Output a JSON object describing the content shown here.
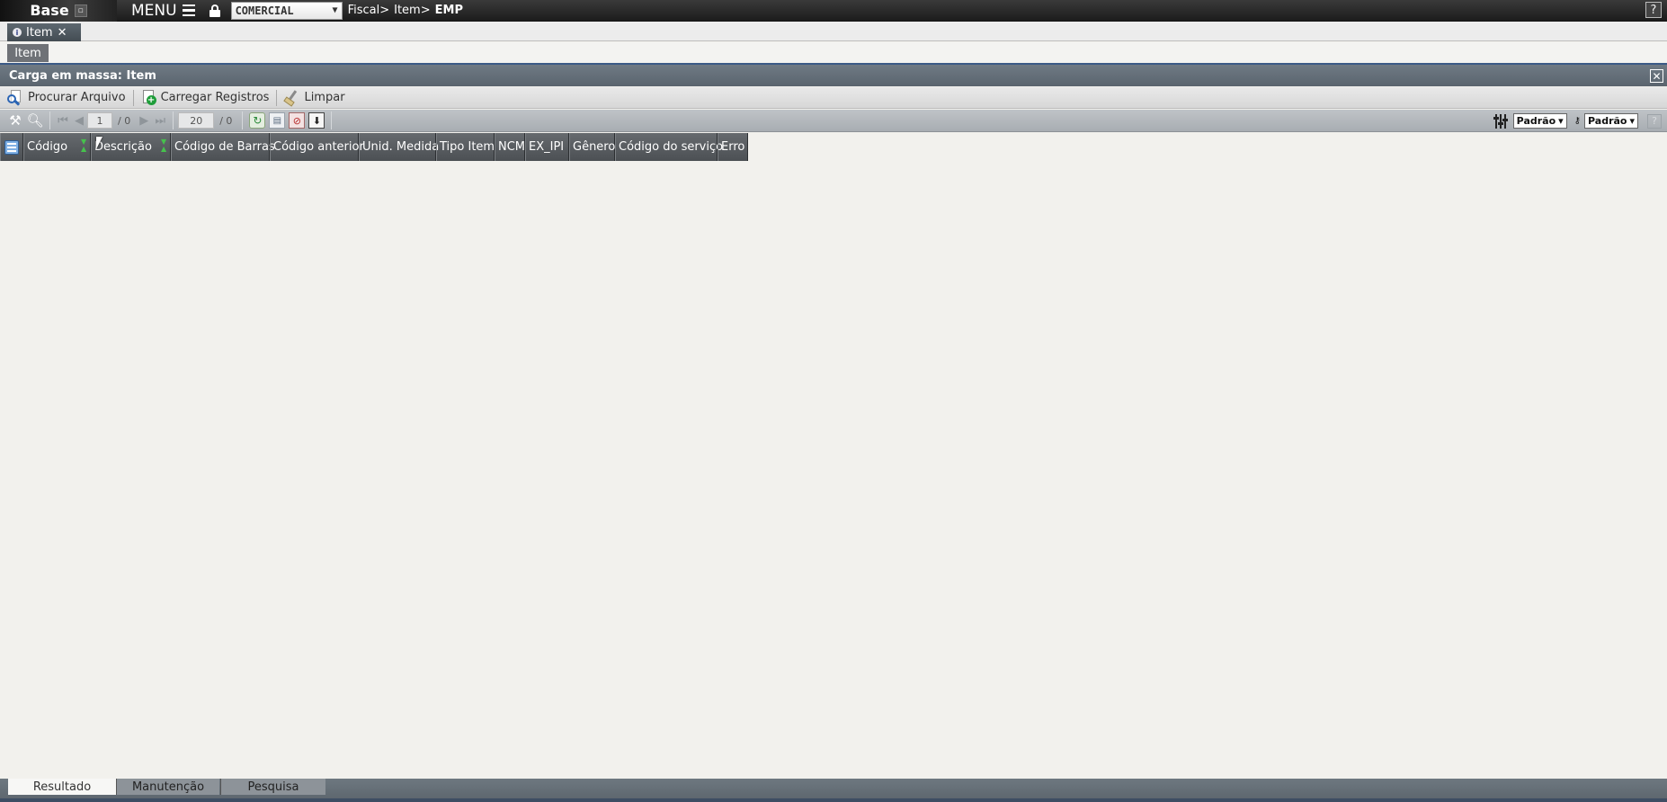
{
  "topbar": {
    "brand": "Base",
    "menu_label": "MENU",
    "company": "COMERCIAL",
    "breadcrumb": [
      "Fiscal>",
      "Item>",
      "EMP"
    ],
    "help": "?"
  },
  "doc_tab": {
    "label": "Item",
    "close": "✕"
  },
  "sub_tab": {
    "label": "Item"
  },
  "panel": {
    "title": "Carga em massa: Item",
    "close": "✕"
  },
  "actions": {
    "browse": "Procurar Arquivo",
    "load": "Carregar Registros",
    "clear": "Limpar"
  },
  "pager": {
    "page": "1",
    "page_total": "/ 0",
    "rows": "20",
    "rows_total": "/ 0"
  },
  "view_select": "Padrão",
  "key_select": "Padrão",
  "columns": [
    "Código",
    "Descrição",
    "Código de Barras",
    "Código anterior",
    "Unid. Medida",
    "Tipo Item",
    "NCM",
    "EX_IPI",
    "Gênero",
    "Código do serviço",
    "Erro"
  ],
  "bottom_tabs": [
    "Resultado",
    "Manutenção",
    "Pesquisa"
  ],
  "colors": {
    "header_dark": "#4c5054",
    "panel_header": "#5a646e",
    "accent_blue": "#3b5a87",
    "background": "#f2f1ed"
  }
}
